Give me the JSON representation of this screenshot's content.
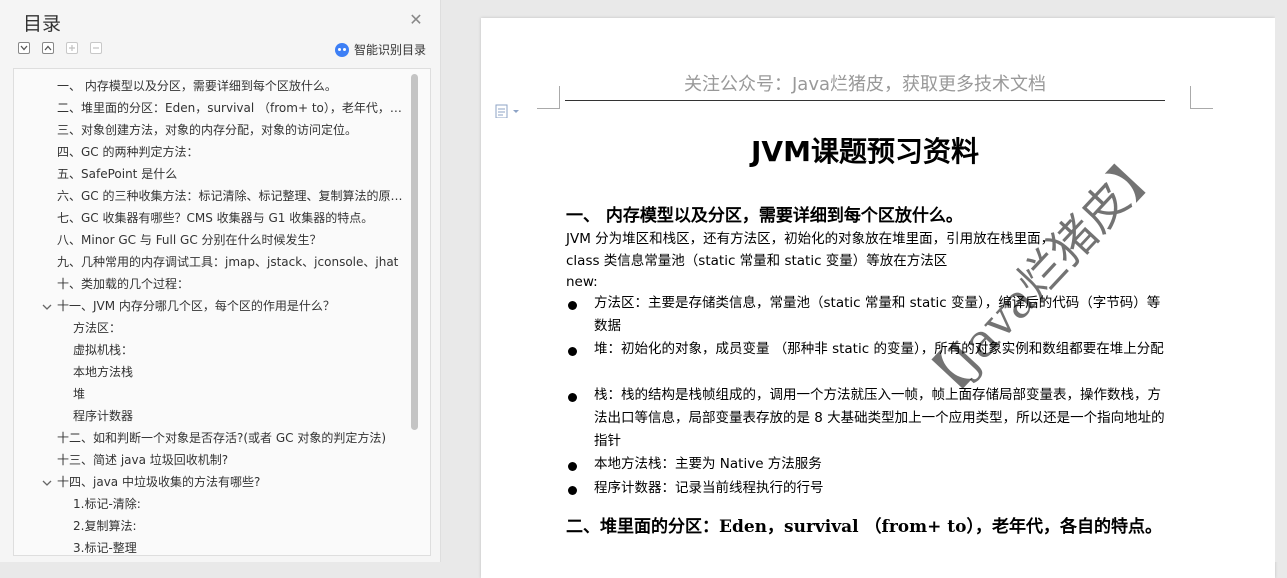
{
  "panel": {
    "title": "目录",
    "smart_label": "智能识别目录",
    "items": [
      {
        "label": "一、 内存模型以及分区，需要详细到每个区放什么。",
        "level": 0
      },
      {
        "label": "二、堆里面的分区：Eden，survival （from+ to），老年代，各自的特点。",
        "level": 0
      },
      {
        "label": "三、对象创建方法，对象的内存分配，对象的访问定位。",
        "level": 0
      },
      {
        "label": "四、GC 的两种判定方法：",
        "level": 0
      },
      {
        "label": "五、SafePoint 是什么",
        "level": 0
      },
      {
        "label": "六、GC 的三种收集方法：标记清除、标记整理、复制算法的原理与特点",
        "level": 0
      },
      {
        "label": "七、GC 收集器有哪些？CMS 收集器与 G1 收集器的特点。",
        "level": 0
      },
      {
        "label": "八、Minor GC 与 Full GC 分别在什么时候发生？",
        "level": 0
      },
      {
        "label": "九、几种常用的内存调试工具：jmap、jstack、jconsole、jhat",
        "level": 0
      },
      {
        "label": "十、类加载的几个过程：",
        "level": 0
      },
      {
        "label": "十一、JVM 内存分哪几个区，每个区的作用是什么？",
        "level": 0,
        "expanded": true
      },
      {
        "label": "方法区：",
        "level": 1
      },
      {
        "label": "虚拟机栈：",
        "level": 1
      },
      {
        "label": "本地方法栈",
        "level": 1
      },
      {
        "label": "堆",
        "level": 1
      },
      {
        "label": "程序计数器",
        "level": 1
      },
      {
        "label": "十二、如和判断一个对象是否存活?(或者 GC 对象的判定方法)",
        "level": 0
      },
      {
        "label": "十三、简述 java 垃圾回收机制?",
        "level": 0
      },
      {
        "label": "十四、java 中垃圾收集的方法有哪些?",
        "level": 0,
        "expanded": true
      },
      {
        "label": "1.标记-清除:",
        "level": 1
      },
      {
        "label": "2.复制算法:",
        "level": 1
      },
      {
        "label": "3.标记-整理",
        "level": 1
      }
    ]
  },
  "document": {
    "header": "关注公众号：Java烂猪皮，获取更多技术文档",
    "title": "JVM课题预习资料",
    "section1_heading": "一、  内存模型以及分区，需要详细到每个区放什么。",
    "para1": "JVM 分为堆区和栈区，还有方法区，初始化的对象放在堆里面，引用放在栈里面，",
    "para2": "class 类信息常量池（static 常量和 static 变量）等放在方法区",
    "para3": "new:",
    "bullets": [
      "方法区：主要是存储类信息，常量池（static 常量和 static 变量），编译后的代码（字节码）等数据",
      "堆：初始化的对象，成员变量 （那种非 static 的变量），所有的对象实例和数组都要在堆上分配",
      "栈：栈的结构是栈帧组成的，调用一个方法就压入一帧，帧上面存储局部变量表，操作数栈，方法出口等信息，局部变量表存放的是 8 大基础类型加上一个应用类型，所以还是一个指向地址的指针",
      "本地方法栈：主要为 Native 方法服务",
      "程序计数器：记录当前线程执行的行号"
    ],
    "section2_heading": "二、堆里面的分区：Eden，survival （from+ to），老年代，各自的特点。",
    "watermark": "【Java烂猪皮】"
  }
}
